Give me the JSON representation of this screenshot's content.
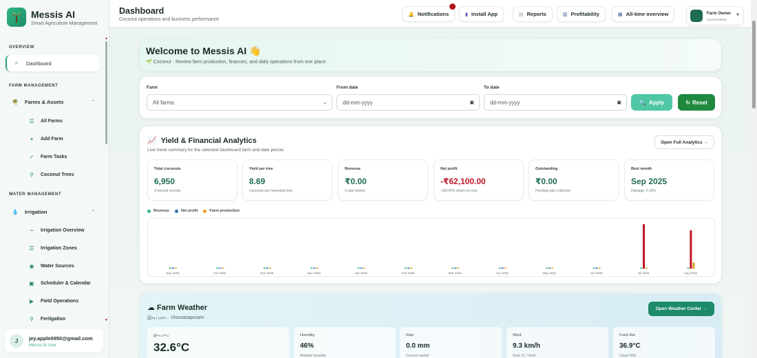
{
  "brand": {
    "title": "Messis AI",
    "subtitle": "Smart Agriculture Management"
  },
  "sidebar": {
    "sections": [
      "OVERVIEW",
      "FARM MANAGEMENT",
      "WATER MANAGEMENT"
    ],
    "dashboard": "Dashboard",
    "farms_assets": {
      "label": "Farms & Assets",
      "items": [
        "All Farms",
        "Add Farm",
        "Farm Tasks",
        "Coconut Trees"
      ]
    },
    "irrigation": {
      "label": "Irrigation",
      "items": [
        "Irrigation Overview",
        "Irrigation Zones",
        "Water Sources",
        "Scheduler & Calendar",
        "Field Operations",
        "Fertigation"
      ]
    },
    "user": {
      "initial": "J",
      "email": "jey.apple0950@gmail.com",
      "role": "Messis AI User"
    }
  },
  "header": {
    "title": "Dashboard",
    "subtitle": "Coconut operations and business performance",
    "buttons": [
      "Notifications",
      "Install App",
      "Reports",
      "Profitability",
      "All-time overview"
    ],
    "profile_name": "Farm Owner",
    "profile_menu": "Account Menu"
  },
  "welcome": {
    "title": "Welcome to Messis AI",
    "wave": "👋",
    "subtitle": "🌱 Coconut · Review farm production, finances, and daily operations from one place."
  },
  "filters": {
    "farm_label": "Farm",
    "farm_value": "All farms",
    "from_label": "From date",
    "from_placeholder": "dd-mm-yyyy",
    "to_label": "To date",
    "to_placeholder": "dd-mm-yyyy",
    "apply": "Apply",
    "reset": "Reset"
  },
  "analytics": {
    "title": "Yield & Financial Analytics",
    "subtitle": "Live trend summary for the selected dashboard farm and date period.",
    "open_button": "Open Full Analytics →",
    "kpis": [
      {
        "label": "Total coconuts",
        "value": "6,950",
        "note": "3 harvest records",
        "negative": false
      },
      {
        "label": "Yield per tree",
        "value": "8.69",
        "note": "Coconuts per harvested tree",
        "negative": false
      },
      {
        "label": "Revenue",
        "value": "₹0.00",
        "note": "0 sale entries",
        "negative": false
      },
      {
        "label": "Net profit",
        "value": "-₹62,100.00",
        "note": "-100.00% return on cost",
        "negative": true
      },
      {
        "label": "Outstanding",
        "value": "₹0.00",
        "note": "Pending sale collection",
        "negative": false
      },
      {
        "label": "Best month",
        "value": "Sep 2025",
        "note": "Damage: 2.16%",
        "negative": false
      }
    ]
  },
  "chart_data": {
    "type": "bar",
    "categories": [
      "Sep 2025",
      "Oct 2025",
      "Nov 2025",
      "Dec 2025",
      "Jan 2026",
      "Feb 2026",
      "Mar 2026",
      "Apr 2026",
      "May 2026",
      "Jun 2026",
      "Jul 2026",
      "Aug 2026"
    ],
    "series": [
      {
        "name": "Revenue",
        "color": "#2fb37a",
        "values": [
          0,
          0,
          0,
          0,
          0,
          0,
          0,
          0,
          0,
          0,
          0,
          0
        ]
      },
      {
        "name": "Net profit",
        "color": "#2f6fb3",
        "values": [
          0,
          0,
          0,
          0,
          0,
          0,
          0,
          0,
          0,
          0,
          -58000,
          -50000
        ]
      },
      {
        "name": "Farm production",
        "color": "#e0a020",
        "values": [
          0,
          0,
          0,
          0,
          0,
          0,
          0,
          0,
          0,
          0,
          0,
          8000
        ]
      }
    ],
    "negative_color": "#c0101f",
    "ylim": [
      -60000,
      60000
    ],
    "grid": false,
    "legend": "top-left"
  },
  "weather": {
    "title": "☁ Farm Weather",
    "location": "இடிபுரவு · Visuvasapuram",
    "button": "Open Weather Center →",
    "current": {
      "label": "இடிபுரவு",
      "value": "32.6°C"
    },
    "metrics": [
      {
        "label": "Humidity",
        "value": "46%",
        "note": "Relative humidity"
      },
      {
        "label": "Rain",
        "value": "0.0 mm",
        "note": "Current rainfall"
      },
      {
        "label": "Wind",
        "value": "9.3 km/h",
        "note": "Gust 31.7 km/h"
      },
      {
        "label": "Feels like",
        "value": "36.9°C",
        "note": "Cloud 36%"
      }
    ]
  }
}
